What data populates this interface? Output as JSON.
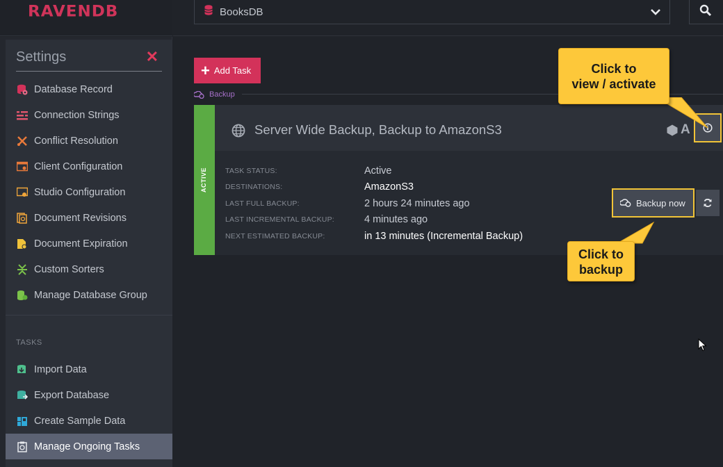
{
  "app": {
    "logo_text": "RAVENDB",
    "accent_color": "#d3325a"
  },
  "topbar": {
    "database": "BooksDB"
  },
  "settings": {
    "title": "Settings",
    "close": "✕",
    "items": [
      {
        "label": "Database Record",
        "icon": "database-record-icon"
      },
      {
        "label": "Connection Strings",
        "icon": "connection-strings-icon"
      },
      {
        "label": "Conflict Resolution",
        "icon": "conflict-icon"
      },
      {
        "label": "Client Configuration",
        "icon": "client-config-icon"
      },
      {
        "label": "Studio Configuration",
        "icon": "studio-config-icon"
      },
      {
        "label": "Document Revisions",
        "icon": "revisions-icon"
      },
      {
        "label": "Document Expiration",
        "icon": "expiration-icon"
      },
      {
        "label": "Custom Sorters",
        "icon": "sorters-icon"
      },
      {
        "label": "Manage Database Group",
        "icon": "db-group-icon"
      }
    ],
    "tasks_heading": "TASKS",
    "tasks": [
      {
        "label": "Import Data",
        "icon": "import-icon"
      },
      {
        "label": "Export Database",
        "icon": "export-icon"
      },
      {
        "label": "Create Sample Data",
        "icon": "sample-data-icon"
      },
      {
        "label": "Manage Ongoing Tasks",
        "icon": "ongoing-tasks-icon",
        "active": true
      }
    ]
  },
  "main": {
    "add_task": "Add Task",
    "section": "Backup",
    "task": {
      "status_strip": "ACTIVE",
      "name": "Server Wide Backup, Backup to AmazonS3",
      "node": "A",
      "details": [
        {
          "label": "TASK STATUS:",
          "value": "Active"
        },
        {
          "label": "DESTINATIONS:",
          "value": "AmazonS3"
        },
        {
          "label": "LAST FULL BACKUP:",
          "value": "2 hours 24 minutes ago"
        },
        {
          "label": "LAST INCREMENTAL BACKUP:",
          "value": "4 minutes ago"
        },
        {
          "label": "NEXT ESTIMATED BACKUP:",
          "value": "in 13 minutes (Incremental Backup)"
        }
      ],
      "backup_now": "Backup now"
    }
  },
  "callouts": {
    "activate": {
      "line1": "Click to",
      "line2": "view / activate"
    },
    "backup": {
      "line1": "Click to",
      "line2": "backup"
    }
  }
}
